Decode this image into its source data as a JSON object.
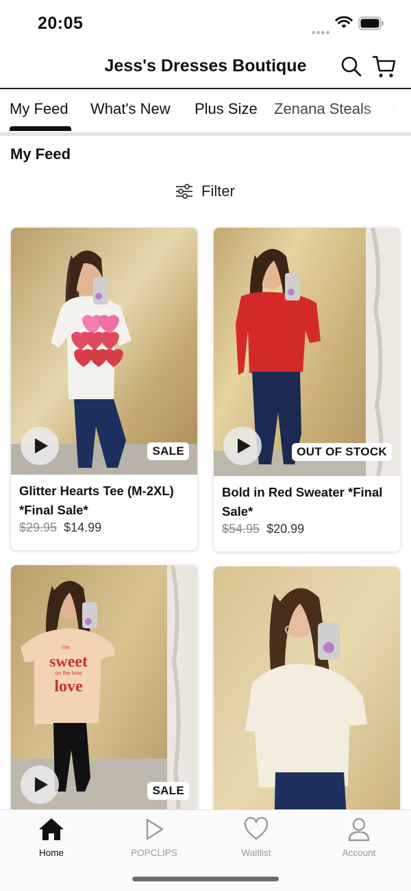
{
  "status_bar": {
    "time": "20:05"
  },
  "header": {
    "title": "Jess's Dresses Boutique"
  },
  "tabs": [
    {
      "label": "My Feed",
      "active": true
    },
    {
      "label": "What's New",
      "active": false
    },
    {
      "label": "Plus Size",
      "active": false
    },
    {
      "label": "Zenana Steals",
      "active": false
    },
    {
      "label": "T",
      "active": false
    }
  ],
  "section_title": "My Feed",
  "filter": {
    "label": "Filter"
  },
  "products": [
    {
      "name": "Glitter Hearts Tee (M-2XL) *Final Sale*",
      "old_price": "$29.95",
      "price": "$14.99",
      "badge": "SALE"
    },
    {
      "name": "Bold in Red Sweater *Final Sale*",
      "old_price": "$54.95",
      "price": "$20.99",
      "badge": "OUT OF STOCK"
    },
    {
      "badge": "SALE",
      "graphic_text": "sweet love"
    },
    {}
  ],
  "bottom_nav": [
    {
      "label": "Home",
      "icon": "home-icon",
      "active": true
    },
    {
      "label": "POPCLIPS",
      "icon": "play-icon",
      "active": false
    },
    {
      "label": "Waitlist",
      "icon": "heart-icon",
      "active": false
    },
    {
      "label": "Account",
      "icon": "person-icon",
      "active": false
    }
  ],
  "colors": {
    "accent": "#111111",
    "inactive": "#9a9a9a",
    "backdrop": "#c9b27c",
    "sweater_red": "#d42a27"
  }
}
